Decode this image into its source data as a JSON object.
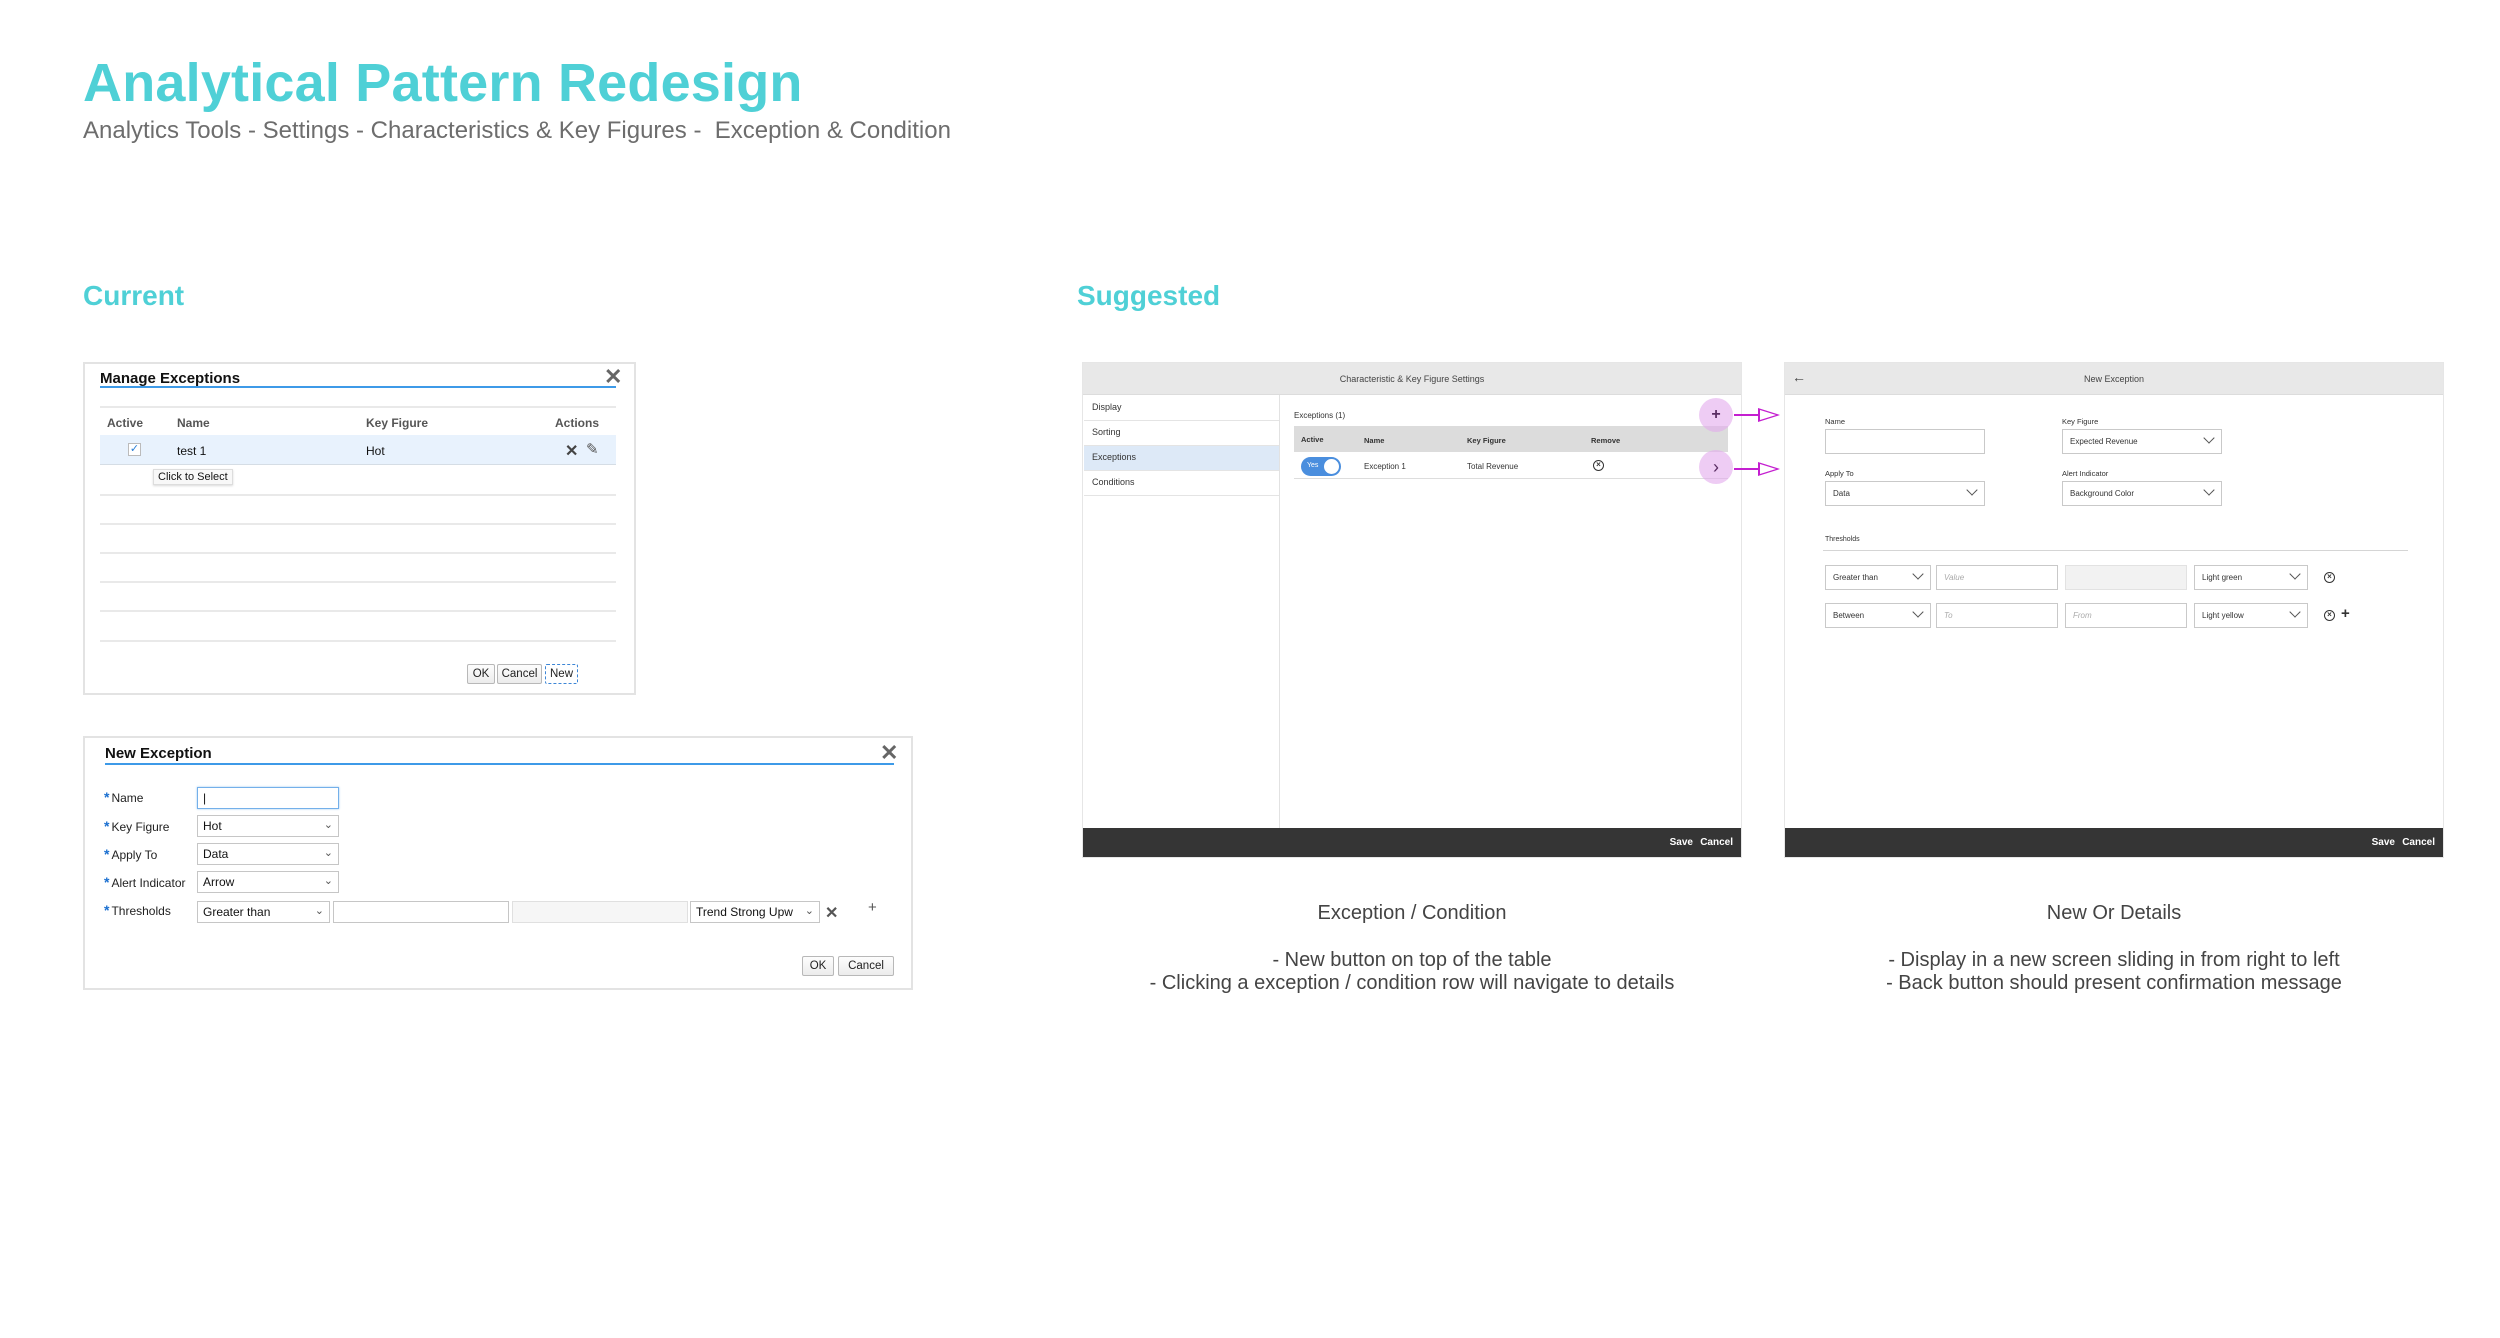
{
  "header": {
    "title": "Analytical Pattern Redesign",
    "subtitle": "Analytics Tools - Settings - Characteristics & Key Figures -  Exception & Condition"
  },
  "sections": {
    "current": "Current",
    "suggested": "Suggested"
  },
  "colors": {
    "accent": "#4fd0d6",
    "classic_rule": "#3d9ae8",
    "highlight": "#c41fd0",
    "footer_bar": "#353535",
    "toggle_on": "#4a8ede"
  },
  "manage_exceptions": {
    "title": "Manage Exceptions",
    "close_icon": "close-icon",
    "columns": [
      "Active",
      "Name",
      "Key Figure",
      "Actions"
    ],
    "rows": [
      {
        "active": true,
        "name": "test 1",
        "key_figure": "Hot",
        "actions": [
          "delete-icon",
          "edit-icon"
        ]
      }
    ],
    "tooltip": "Click to Select",
    "buttons": {
      "ok": "OK",
      "cancel": "Cancel",
      "new": "New"
    }
  },
  "new_exception_classic": {
    "title": "New Exception",
    "fields": {
      "name": {
        "label": "Name",
        "value": "|"
      },
      "key_figure": {
        "label": "Key Figure",
        "value": "Hot"
      },
      "apply_to": {
        "label": "Apply To",
        "value": "Data"
      },
      "alert_indicator": {
        "label": "Alert Indicator",
        "value": "Arrow"
      },
      "thresholds": {
        "label": "Thresholds",
        "operator": "Greater than",
        "value": "",
        "value2": "",
        "indicator": "Trend Strong Upw"
      }
    },
    "buttons": {
      "ok": "OK",
      "cancel": "Cancel"
    },
    "add_symbol": "+",
    "remove_symbol": "✕"
  },
  "settings_panel": {
    "title": "Characteristic & Key Figure Settings",
    "nav": [
      "Display",
      "Sorting",
      "Exceptions",
      "Conditions"
    ],
    "selected_nav": "Exceptions",
    "list_title": "Exceptions (1)",
    "columns": [
      "Active",
      "Name",
      "Key Figure",
      "Remove"
    ],
    "rows": [
      {
        "active_label": "Yes",
        "name": "Exception 1",
        "key_figure": "Total Revenue"
      }
    ],
    "add_symbol": "+",
    "detail_symbol": "›",
    "footer": {
      "save": "Save",
      "cancel": "Cancel"
    }
  },
  "new_exception_panel": {
    "title": "New Exception",
    "back_icon": "←",
    "fields": {
      "name": {
        "label": "Name",
        "value": ""
      },
      "key_figure": {
        "label": "Key Figure",
        "value": "Expected Revenue"
      },
      "apply_to": {
        "label": "Apply To",
        "value": "Data"
      },
      "alert_indicator": {
        "label": "Alert Indicator",
        "value": "Background Color"
      }
    },
    "thresholds_label": "Thresholds",
    "thresholds": [
      {
        "operator": "Greater than",
        "value1_placeholder": "Value",
        "value2_placeholder": "",
        "color": "Light green"
      },
      {
        "operator": "Between",
        "value1_placeholder": "To",
        "value2_placeholder": "From",
        "color": "Light yellow"
      }
    ],
    "add_symbol": "+",
    "footer": {
      "save": "Save",
      "cancel": "Cancel"
    }
  },
  "captions": {
    "exception_condition": {
      "title": "Exception / Condition",
      "bullets": [
        "- New button on top of the table",
        "- Clicking a exception / condition row will navigate to details"
      ]
    },
    "new_or_details": {
      "title": "New Or Details",
      "bullets": [
        "- Display in a new screen sliding in from right to left",
        "- Back button should present confirmation message"
      ]
    }
  }
}
